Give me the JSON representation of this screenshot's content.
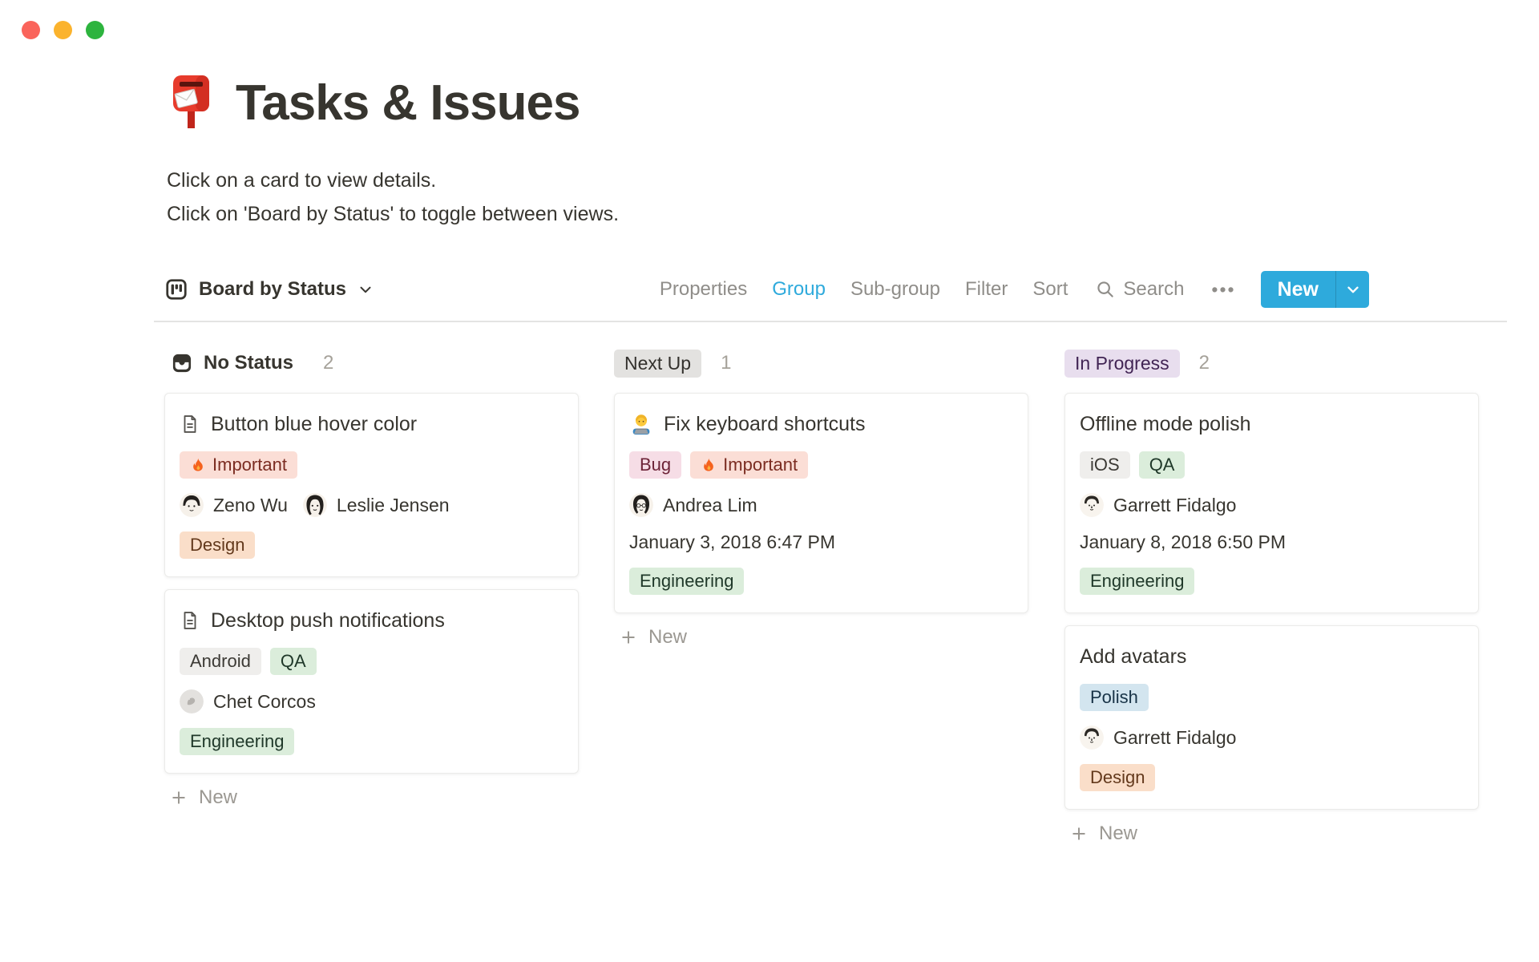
{
  "window": {
    "controls": {
      "close": "close",
      "minimize": "minimize",
      "zoom": "zoom"
    }
  },
  "page": {
    "icon": "postbox",
    "title": "Tasks & Issues",
    "subtitle1": "Click on a card to view details.",
    "subtitle2": "Click on 'Board by Status' to toggle between views."
  },
  "toolbar": {
    "view_label": "Board by Status",
    "items": [
      {
        "label": "Properties",
        "active": false
      },
      {
        "label": "Group",
        "active": true
      },
      {
        "label": "Sub-group",
        "active": false
      },
      {
        "label": "Filter",
        "active": false
      },
      {
        "label": "Sort",
        "active": false
      }
    ],
    "search_label": "Search",
    "more_label": "•••",
    "new_label": "New"
  },
  "board": {
    "columns": [
      {
        "label": "No Status",
        "count": "2",
        "header_style": "plain-with-inbox-icon",
        "new_label": "New",
        "cards": [
          {
            "title": "Button blue hover color",
            "icon": "page",
            "tags_top": [
              {
                "label": "Important",
                "color": "red",
                "icon": "fire"
              }
            ],
            "people": [
              {
                "name": "Zeno Wu"
              },
              {
                "name": "Leslie Jensen"
              }
            ],
            "tags_bottom": [
              {
                "label": "Design",
                "color": "orange"
              }
            ]
          },
          {
            "title": "Desktop push notifications",
            "icon": "page",
            "tags_top": [
              {
                "label": "Android",
                "color": "gray"
              },
              {
                "label": "QA",
                "color": "green"
              }
            ],
            "people": [
              {
                "name": "Chet Corcos"
              }
            ],
            "tags_bottom": [
              {
                "label": "Engineering",
                "color": "green"
              }
            ]
          }
        ]
      },
      {
        "label": "Next Up",
        "count": "1",
        "header_style": "gray-pill",
        "new_label": "New",
        "cards": [
          {
            "title": "Fix keyboard shortcuts",
            "icon": "technologist",
            "tags_top": [
              {
                "label": "Bug",
                "color": "pink"
              },
              {
                "label": "Important",
                "color": "red",
                "icon": "fire"
              }
            ],
            "people": [
              {
                "name": "Andrea Lim"
              }
            ],
            "date": "January 3, 2018 6:47 PM",
            "tags_bottom": [
              {
                "label": "Engineering",
                "color": "green"
              }
            ]
          }
        ]
      },
      {
        "label": "In Progress",
        "count": "2",
        "header_style": "purple-pill",
        "new_label": "New",
        "cards": [
          {
            "title": "Offline mode polish",
            "tags_top": [
              {
                "label": "iOS",
                "color": "gray"
              },
              {
                "label": "QA",
                "color": "green"
              }
            ],
            "people": [
              {
                "name": "Garrett Fidalgo"
              }
            ],
            "date": "January 8, 2018 6:50 PM",
            "tags_bottom": [
              {
                "label": "Engineering",
                "color": "green"
              }
            ]
          },
          {
            "title": "Add avatars",
            "tags_top": [
              {
                "label": "Polish",
                "color": "blue"
              }
            ],
            "people": [
              {
                "name": "Garrett Fidalgo"
              }
            ],
            "tags_bottom": [
              {
                "label": "Design",
                "color": "orange"
              }
            ]
          }
        ]
      }
    ]
  },
  "colors": {
    "accent_blue": "#2eaadc",
    "text": "#37352f",
    "muted_text": "#8f8d89",
    "tag_red_bg": "#fbded6",
    "tag_pink_bg": "#f6dde6",
    "tag_orange_bg": "#fadec9",
    "tag_gray_bg": "#efeeec",
    "tag_green_bg": "#dbeddb",
    "tag_blue_bg": "#d3e5ef",
    "next_up_pill_bg": "#e3e2e0",
    "in_progress_pill_bg": "#e8deee",
    "traffic_red": "#fa645b",
    "traffic_yellow": "#fbb32d",
    "traffic_green": "#2db43e"
  }
}
